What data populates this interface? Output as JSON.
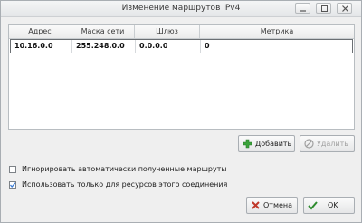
{
  "window": {
    "title": "Изменение маршрутов IPv4"
  },
  "table": {
    "headers": [
      "Адрес",
      "Маска сети",
      "Шлюз",
      "Метрика"
    ],
    "rows": [
      {
        "address": "10.16.0.0",
        "netmask": "255.248.0.0",
        "gateway": "0.0.0.0",
        "metric": "0"
      }
    ]
  },
  "buttons": {
    "add": "Добавить",
    "delete": "Удалить",
    "cancel": "Отмена",
    "ok": "OK"
  },
  "options": {
    "ignore_auto": {
      "label": "Игнорировать автоматически полученные маршруты",
      "checked": false
    },
    "only_this_connection": {
      "label": "Использовать только для ресурсов этого соединения",
      "checked": true
    }
  },
  "colors": {
    "add_icon": "#3aa33a",
    "ok_icon": "#2e8b2e",
    "cancel_icon": "#c0392b",
    "check_mark": "#3a7bd5"
  }
}
